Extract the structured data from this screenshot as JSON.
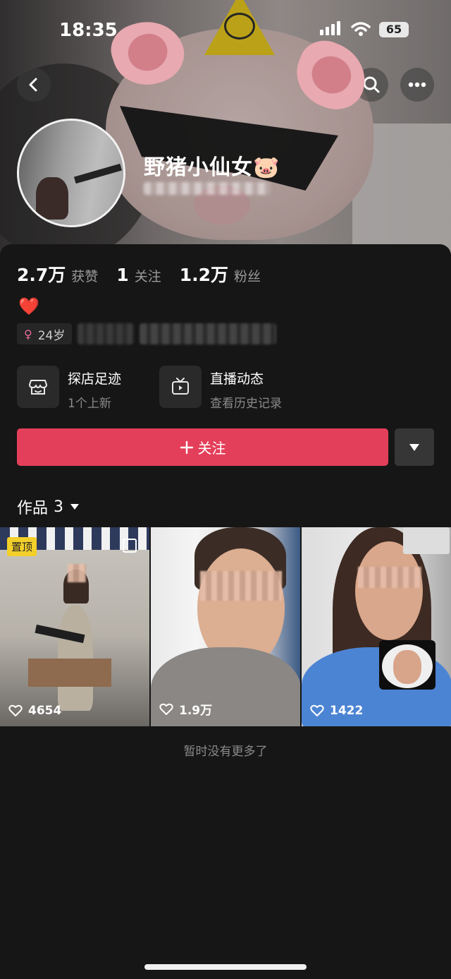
{
  "status_bar": {
    "time": "18:35",
    "battery": "65"
  },
  "profile": {
    "name": "野猪小仙女",
    "name_emoji": "🐷",
    "bio_emoji": "❤️",
    "age_tag": "24岁",
    "age_symbol": "♀"
  },
  "stats": [
    {
      "value": "2.7万",
      "label": "获赞"
    },
    {
      "value": "1",
      "label": "关注"
    },
    {
      "value": "1.2万",
      "label": "粉丝"
    }
  ],
  "features": [
    {
      "title": "探店足迹",
      "subtitle": "1个上新",
      "icon": "store-icon"
    },
    {
      "title": "直播动态",
      "subtitle": "查看历史记录",
      "icon": "tv-icon"
    }
  ],
  "follow_button": {
    "label": "关注",
    "icon": "plus-icon"
  },
  "works": {
    "label": "作品",
    "count": "3",
    "items": [
      {
        "pinned_label": "置顶",
        "likes": "4654",
        "multi": true
      },
      {
        "likes": "1.9万"
      },
      {
        "likes": "1422"
      }
    ]
  },
  "footer": {
    "no_more": "暂时没有更多了"
  },
  "colors": {
    "accent": "#e43f5a",
    "pinned": "#f3cf2a",
    "background": "#161616"
  }
}
